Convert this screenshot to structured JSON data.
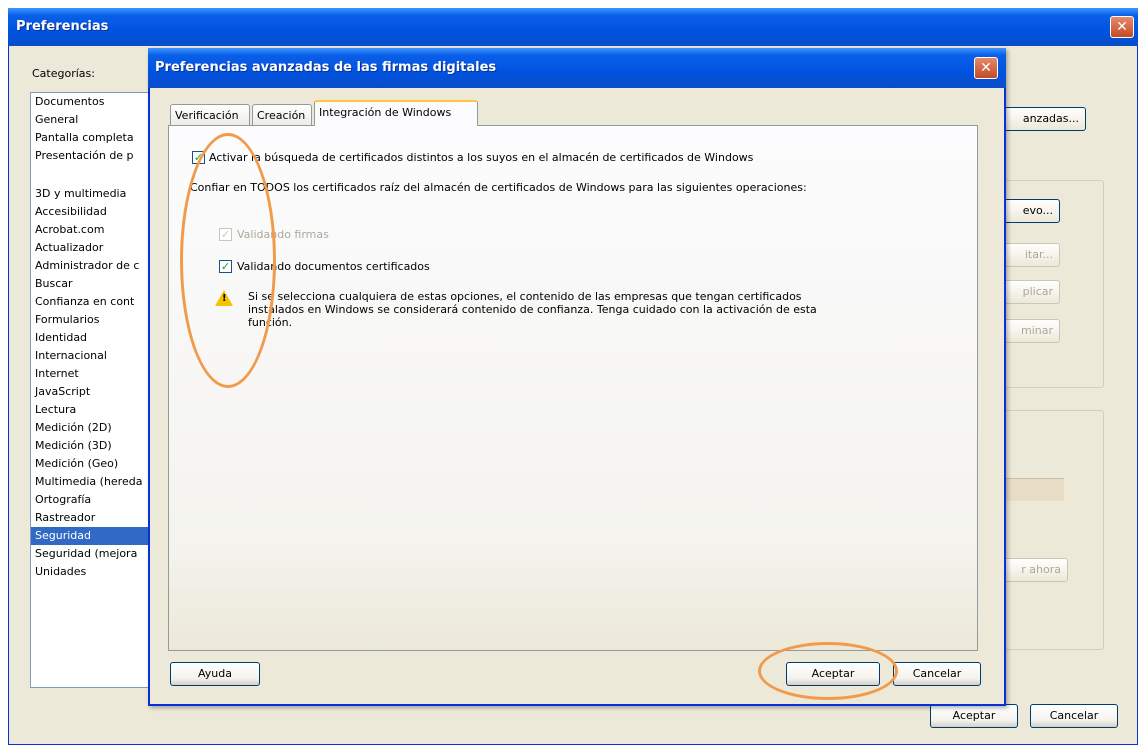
{
  "outer": {
    "title": "Preferencias",
    "close_icon": "close-icon",
    "categories_label": "Categorías:",
    "categories_group1": [
      "Documentos",
      "General",
      "Pantalla completa",
      "Presentación de p"
    ],
    "categories_group2": [
      "3D y multimedia",
      "Accesibilidad",
      "Acrobat.com",
      "Actualizador",
      "Administrador de c",
      "Buscar",
      "Confianza en cont",
      "Formularios",
      "Identidad",
      "Internacional",
      "Internet",
      "JavaScript",
      "Lectura",
      "Medición (2D)",
      "Medición (3D)",
      "Medición (Geo)",
      "Multimedia (hereda",
      "Ortografía",
      "Rastreador",
      "Seguridad",
      "Seguridad (mejora",
      "Unidades"
    ],
    "selected_category": "Seguridad",
    "right_buttons": {
      "avanzadas": "anzadas...",
      "nuevo": "evo...",
      "editar": "itar...",
      "duplicar": "plicar",
      "eliminar": "minar",
      "ahora": "r ahora"
    },
    "ok_label": "Aceptar",
    "cancel_label": "Cancelar"
  },
  "dialog": {
    "title": "Preferencias avanzadas de las firmas digitales",
    "close_icon": "close-icon",
    "tabs": [
      {
        "label": "Verificación",
        "active": false
      },
      {
        "label": "Creación",
        "active": false
      },
      {
        "label": "Integración de Windows",
        "active": true
      }
    ],
    "enable_search_label": "Activar la búsqueda de certificados distintos a los suyos en el almacén de certificados de Windows",
    "enable_search_checked": true,
    "trust_text": "Confiar en TODOS los certificados raíz del almacén de certificados de Windows para las siguientes operaciones:",
    "validate_signatures_label": "Validando firmas",
    "validate_signatures_checked": true,
    "validate_signatures_disabled": true,
    "validate_certified_label": "Validando documentos certificados",
    "validate_certified_checked": true,
    "warning_icon": "warning-icon",
    "warning_text": "Si se selecciona cualquiera de estas opciones, el contenido de las empresas que tengan certificados instalados en Windows se considerará contenido de confianza. Tenga cuidado con la activación de esta función.",
    "help_label": "Ayuda",
    "ok_label": "Aceptar",
    "cancel_label": "Cancelar"
  },
  "colors": {
    "title_bar": "#0053e1",
    "selection": "#316ac5",
    "annotation": "#f29a4b",
    "window_bg": "#ece9d8"
  }
}
